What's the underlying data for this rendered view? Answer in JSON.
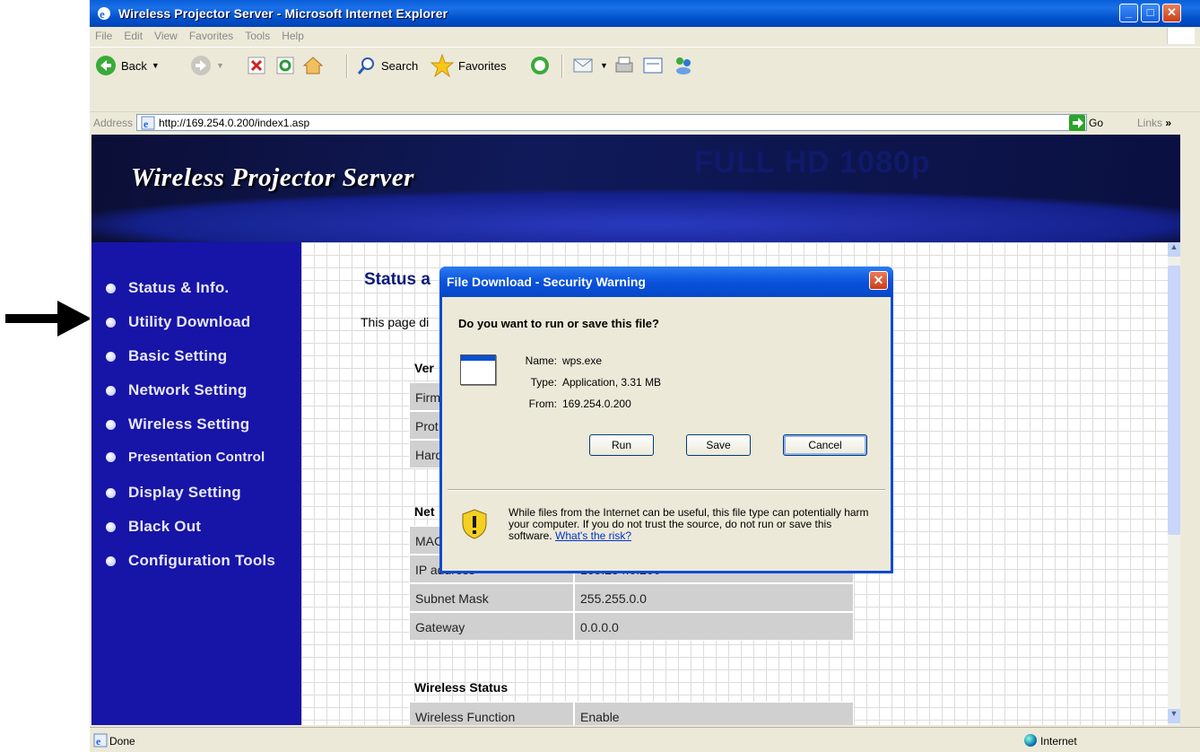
{
  "browser": {
    "title": "Wireless Projector Server - Microsoft Internet Explorer",
    "menu": [
      "File",
      "Edit",
      "View",
      "Favorites",
      "Tools",
      "Help"
    ],
    "toolbar": {
      "back": "Back",
      "search": "Search",
      "favorites": "Favorites"
    },
    "address": {
      "label": "Address",
      "url": "http://169.254.0.200/index1.asp",
      "go": "Go",
      "links": "Links"
    },
    "status": {
      "left": "Done",
      "zone": "Internet"
    }
  },
  "page": {
    "banner": {
      "title": "Wireless Projector Server",
      "subtitle": "FULL HD 1080p"
    },
    "nav": [
      {
        "label": "Status & Info."
      },
      {
        "label": "Utility Download"
      },
      {
        "label": "Basic Setting"
      },
      {
        "label": "Network Setting"
      },
      {
        "label": "Wireless Setting"
      },
      {
        "label": "Presentation Control"
      },
      {
        "label": "Display Setting"
      },
      {
        "label": "Black Out"
      },
      {
        "label": "Configuration Tools"
      }
    ],
    "heading": "Status a",
    "intro": "This page di",
    "sections": {
      "version": "Ver",
      "network": "Net",
      "wireless": "Wireless Status"
    },
    "version_rows": [
      "Firm",
      "Prot",
      "Hard"
    ],
    "network_rows": [
      {
        "k": "MAC",
        "v": ""
      },
      {
        "k": "IP address",
        "v": "169.254.0.200"
      },
      {
        "k": "Subnet Mask",
        "v": "255.255.0.0"
      },
      {
        "k": "Gateway",
        "v": "0.0.0.0"
      }
    ],
    "wireless_rows": [
      {
        "k": "Wireless Function",
        "v": "Enable"
      }
    ]
  },
  "dialog": {
    "title": "File Download - Security Warning",
    "question": "Do you want to run or save this file?",
    "name_label": "Name:",
    "name": "wps.exe",
    "type_label": "Type:",
    "type": "Application, 3.31 MB",
    "from_label": "From:",
    "from": "169.254.0.200",
    "run": "Run",
    "save": "Save",
    "cancel": "Cancel",
    "warning": "While files from the Internet can be useful, this file type can potentially harm your computer. If you do not trust the source, do not run or save this software.",
    "risk_link": "What's the risk?"
  },
  "colors": {
    "sidebar": "#1714a8",
    "banner": "#0b0e35",
    "xp_blue": "#0a52dc"
  }
}
